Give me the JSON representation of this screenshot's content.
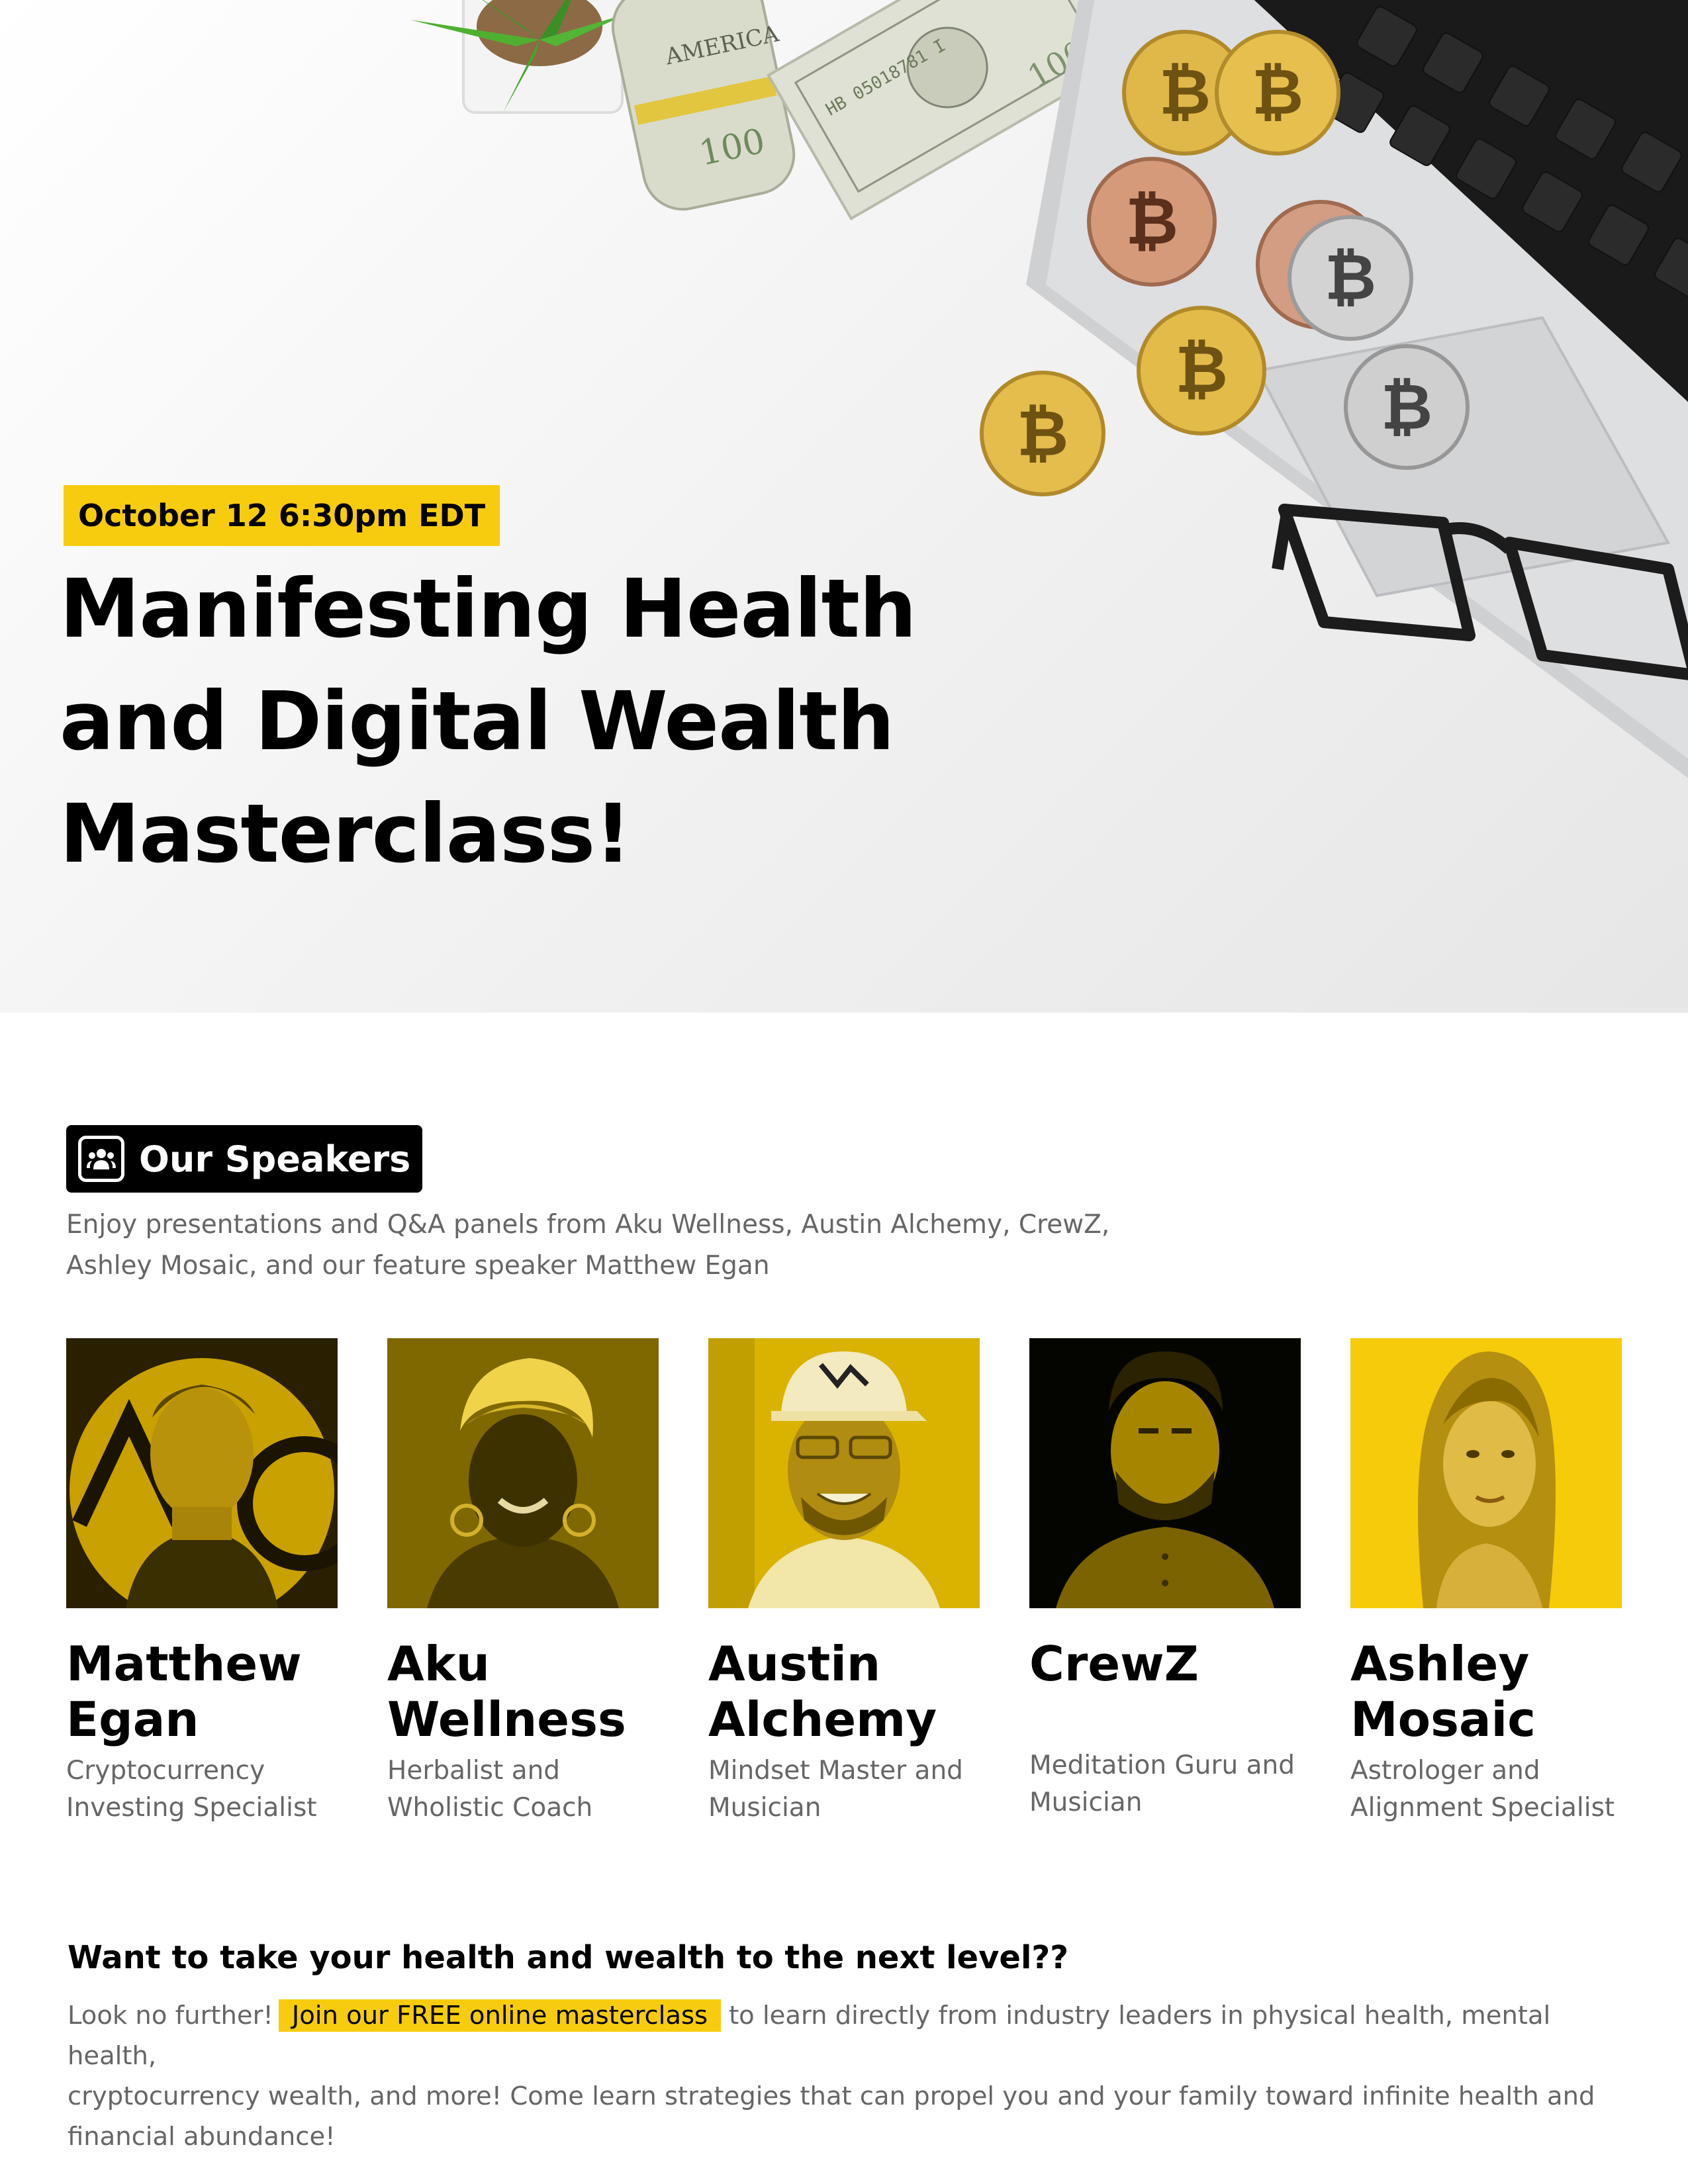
{
  "hero": {
    "date": "October 12 6:30pm EDT",
    "title_lines": [
      "Manifesting Health",
      "and Digital Wealth",
      "Masterclass!"
    ]
  },
  "speakers_section": {
    "badge_label": "Our Speakers",
    "badge_icon": "people-group-icon",
    "intro_lines": [
      "Enjoy presentations and Q&A panels from Aku Wellness, Austin Alchemy, CrewZ,",
      "Ashley Mosaic, and our feature speaker Matthew Egan"
    ],
    "speakers": [
      {
        "name_lines": [
          "Matthew",
          "Egan"
        ],
        "role_lines": [
          "Cryptocurrency",
          "Investing Specialist"
        ]
      },
      {
        "name_lines": [
          "Aku",
          "Wellness"
        ],
        "role_lines": [
          "Herbalist and",
          "Wholistic Coach"
        ]
      },
      {
        "name_lines": [
          "Austin",
          "Alchemy"
        ],
        "role_lines": [
          "Mindset Master and",
          "Musician"
        ]
      },
      {
        "name_lines": [
          "CrewZ",
          ""
        ],
        "role_lines": [
          "Meditation Guru and",
          "Musician"
        ]
      },
      {
        "name_lines": [
          "Ashley",
          "Mosaic"
        ],
        "role_lines": [
          "Astrologer and",
          "Alignment Specialist"
        ]
      }
    ]
  },
  "cta": {
    "heading": "Want to take your health and wealth to the next level??",
    "lead": "Look no further!",
    "highlight": "Join our FREE online masterclass",
    "rest_line1": "to learn directly from industry leaders in physical health, mental health,",
    "line2": "cryptocurrency wealth, and more! Come learn strategies that can propel you and your family toward infinite health and",
    "line3": "financial abundance!"
  },
  "colors": {
    "accent_yellow": "#f8cc0e",
    "text_black": "#000000",
    "text_gray": "#666666"
  }
}
